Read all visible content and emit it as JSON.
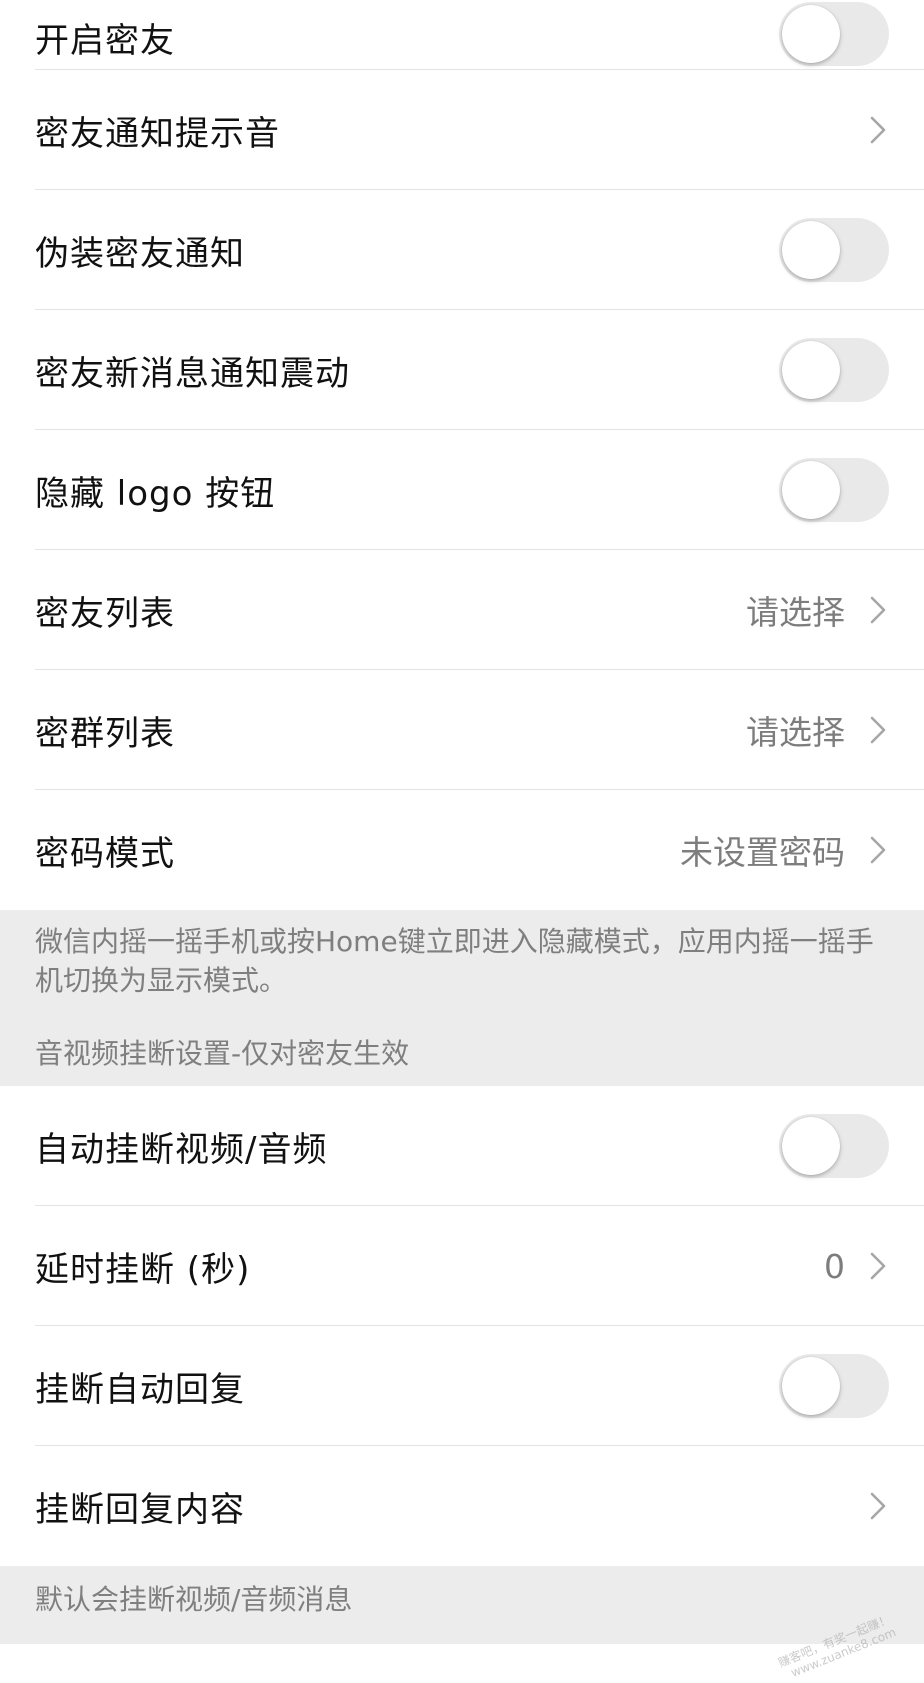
{
  "rows_top": [
    {
      "name": "open-secret-friend",
      "label": "开启密友",
      "control": "toggle",
      "on": false
    },
    {
      "name": "notify-sound",
      "label": "密友通知提示音",
      "control": "chevron",
      "value": ""
    },
    {
      "name": "disguise-notify",
      "label": "伪装密友通知",
      "control": "toggle",
      "on": false
    },
    {
      "name": "vibrate",
      "label": "密友新消息通知震动",
      "control": "toggle",
      "on": false
    },
    {
      "name": "hide-logo",
      "label": "隐藏 logo 按钮",
      "control": "toggle",
      "on": false
    },
    {
      "name": "friend-list",
      "label": "密友列表",
      "control": "chevron",
      "value": "请选择"
    },
    {
      "name": "group-list",
      "label": "密群列表",
      "control": "chevron",
      "value": "请选择"
    },
    {
      "name": "password-mode",
      "label": "密码模式",
      "control": "chevron",
      "value": "未设置密码"
    }
  ],
  "note": {
    "text": "微信内摇一摇手机或按Home键立即进入隐藏模式，应用内摇一摇手机切换为显示模式。",
    "section_header": "音视频挂断设置-仅对密友生效"
  },
  "rows_bottom": [
    {
      "name": "auto-hangup",
      "label": "自动挂断视频/音频",
      "control": "toggle",
      "on": false
    },
    {
      "name": "delay-hangup",
      "label": "延时挂断 (秒)",
      "control": "chevron",
      "value": "0"
    },
    {
      "name": "hangup-auto-reply",
      "label": "挂断自动回复",
      "control": "toggle",
      "on": false
    },
    {
      "name": "hangup-reply-content",
      "label": "挂断回复内容",
      "control": "chevron",
      "value": ""
    }
  ],
  "footer": {
    "text": "默认会挂断视频/音频消息"
  },
  "watermark": {
    "line1": "赚客吧，有奖一起赚！",
    "line2": "www.zuanke8.com"
  },
  "colors": {
    "separator": "#e3e3e3",
    "note_background": "#ececec",
    "toggle_off": "#e9e9ea",
    "secondary_text": "#7d7d7d"
  }
}
